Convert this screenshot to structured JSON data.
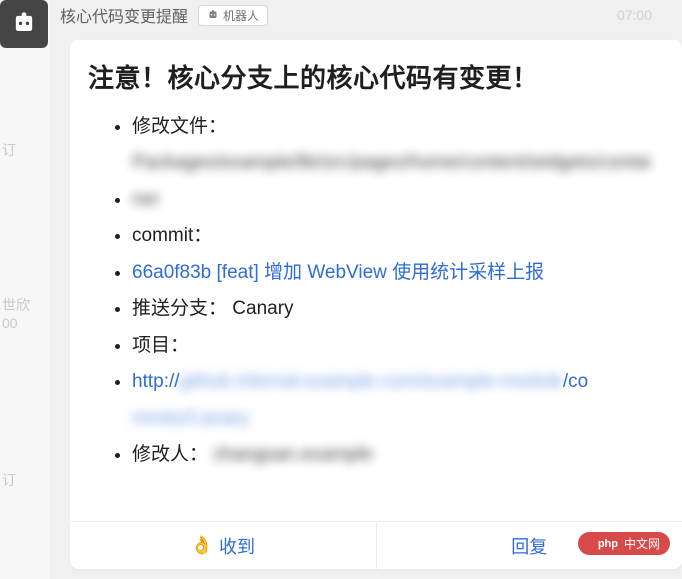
{
  "header": {
    "title": "核心代码变更提醒",
    "bot_label": "机器人",
    "timestamp": "07:00"
  },
  "card": {
    "alert_title": "注意！核心分支上的核心代码有变更！",
    "items": {
      "modified_files_label": "修改文件：",
      "modified_files_blurred": "Packages/example/lib/src/pages/home/content/widgets/container",
      "commit_label": "commit：",
      "commit_link": "66a0f83b [feat] 增加 WebView 使用统计采样上报",
      "push_branch_label": "推送分支：",
      "push_branch_value": "Canary",
      "project_label": "项目：",
      "project_url_prefix": "http://",
      "project_url_blurred": "github.internal.example.com/example-module",
      "project_url_mid": "/co",
      "project_url_blurred2": "mmits/Canary",
      "modifier_label": "修改人：",
      "modifier_blurred": "zhangsan.example"
    }
  },
  "actions": {
    "received_label": "收到",
    "reply_label": "回复"
  },
  "sidebar_hints": {
    "t1": "订",
    "t2": "世欣",
    "t3": "00",
    "t4": "订"
  },
  "watermark": "中文网"
}
